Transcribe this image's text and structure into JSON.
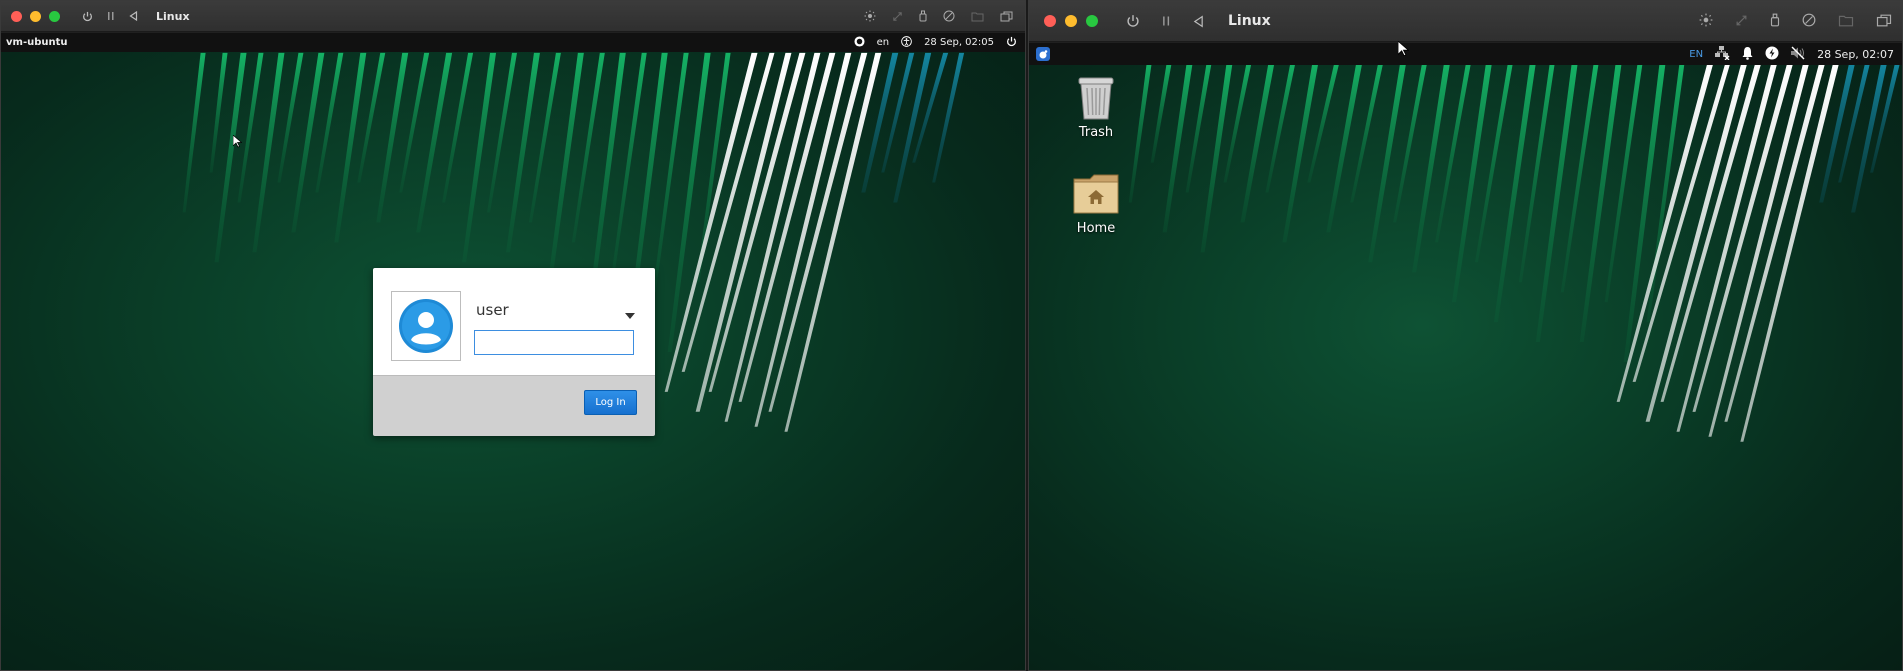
{
  "left_window": {
    "title": "Linux",
    "panel": {
      "hostname": "vm-ubuntu",
      "language": "en",
      "datetime": "28 Sep, 02:05"
    },
    "login": {
      "username": "user",
      "password_value": "",
      "login_button_label": "Log In"
    }
  },
  "right_window": {
    "title": "Linux",
    "panel": {
      "language": "EN",
      "datetime": "28 Sep, 02:07"
    },
    "desktop_icons": [
      {
        "label": "Trash",
        "icon": "trash-icon"
      },
      {
        "label": "Home",
        "icon": "home-folder-icon"
      }
    ]
  },
  "colors": {
    "wallpaper_dark": "#061f15",
    "stripe_green": "#12a35c",
    "stripe_white": "#ffffff",
    "stripe_teal": "#0e6a7a",
    "login_button": "#1670cf"
  }
}
